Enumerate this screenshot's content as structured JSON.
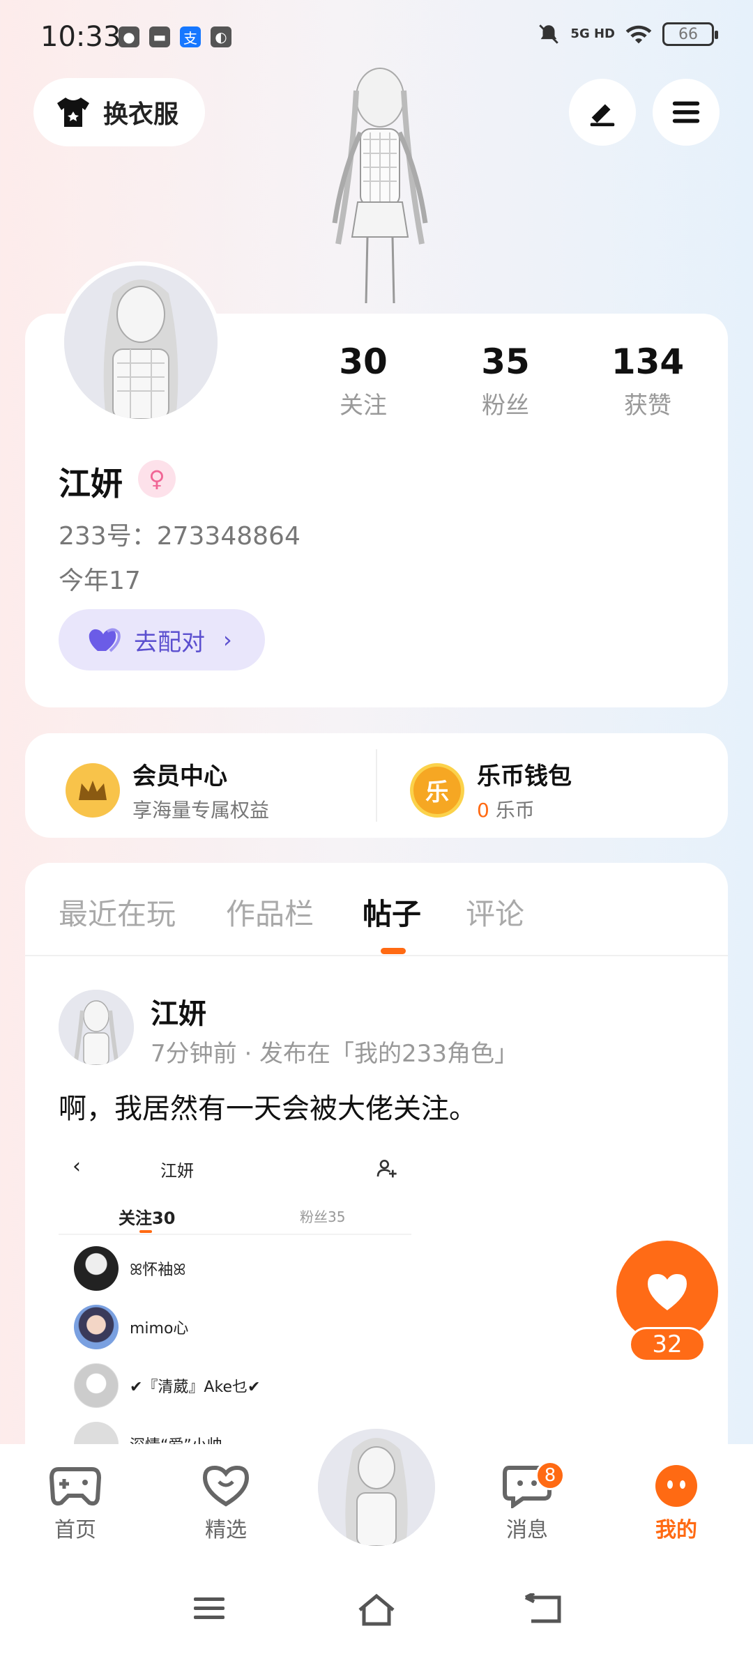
{
  "status_bar": {
    "time": "10:33",
    "network": "5G HD",
    "battery": "66"
  },
  "top": {
    "dress_button": "换衣服"
  },
  "profile": {
    "stats": [
      {
        "value": "30",
        "label": "关注"
      },
      {
        "value": "35",
        "label": "粉丝"
      },
      {
        "value": "134",
        "label": "获赞"
      }
    ],
    "name": "江妍",
    "gender_symbol": "♀",
    "uid": "233号：273348864",
    "age": "今年17",
    "match_button": "去配对"
  },
  "services": {
    "vip_title": "会员中心",
    "vip_sub": "享海量专属权益",
    "wallet_title": "乐币钱包",
    "wallet_amount": "0",
    "wallet_unit": "乐币",
    "wallet_coin_char": "乐"
  },
  "tabs": [
    {
      "label": "最近在玩"
    },
    {
      "label": "作品栏"
    },
    {
      "label": "帖子"
    },
    {
      "label": "评论"
    }
  ],
  "post": {
    "author": "江妍",
    "meta": "7分钟前 · 发布在「我的233角色」",
    "text": "啊，我居然有一天会被大佬关注。",
    "embed": {
      "title": "江妍",
      "tab_follow": "关注30",
      "tab_fans": "粉丝35",
      "follow_list": [
        {
          "name": "ꕤ怀袖ꕤ"
        },
        {
          "name": "mimo心"
        },
        {
          "name": "✔『清葳』Ake乜✔"
        },
        {
          "name": "深情“爱”小帅"
        }
      ]
    },
    "like_count": "32"
  },
  "bottom_nav": {
    "items": [
      {
        "label": "首页"
      },
      {
        "label": "精选"
      },
      {
        "label": "消息"
      },
      {
        "label": "我的"
      }
    ],
    "message_badge": "8"
  },
  "colors": {
    "accent": "#ff6a13",
    "match_bg": "#e9e6fb",
    "match_text": "#5b4fcf"
  }
}
